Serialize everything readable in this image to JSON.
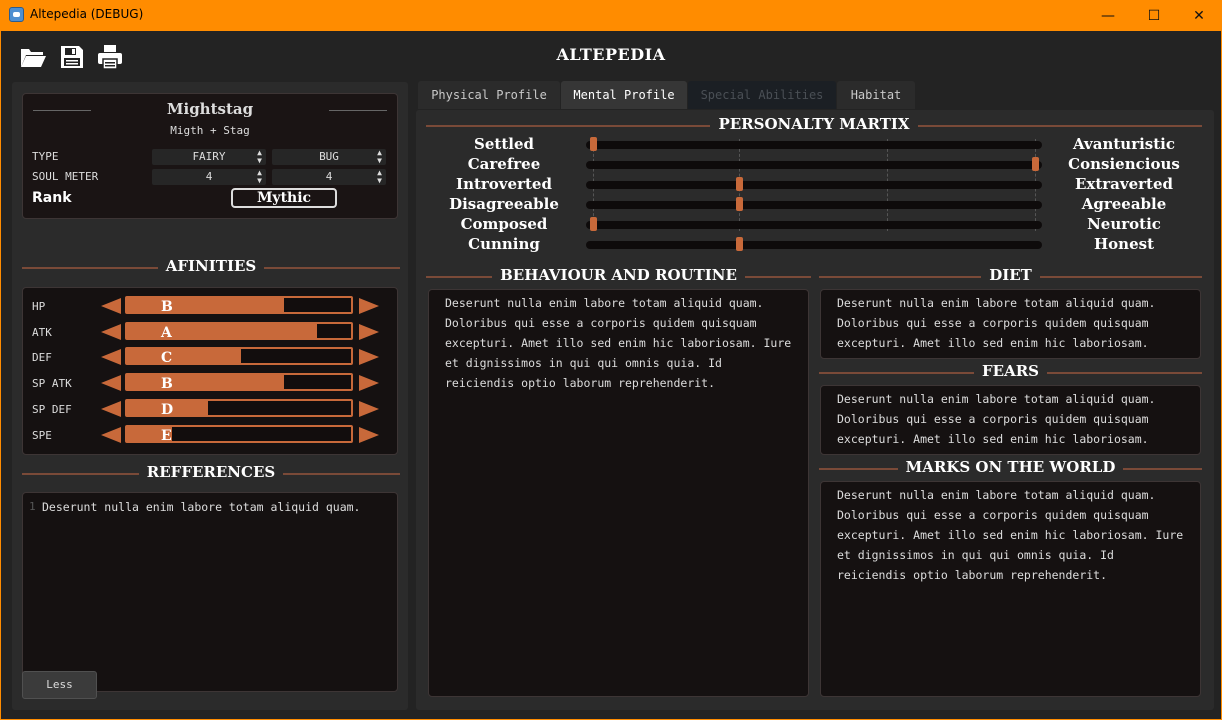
{
  "window": {
    "title": "Altepedia (DEBUG)",
    "controls": {
      "minimize": "—",
      "maximize": "☐",
      "close": "✕"
    }
  },
  "app": {
    "title": "ALTEPEDIA"
  },
  "toolbar": {
    "icons": [
      "folder-open-icon",
      "save-icon",
      "print-icon"
    ]
  },
  "creature": {
    "name": "Mightstag",
    "subtitle": "Migth + Stag",
    "type_label": "TYPE",
    "types": [
      "FAIRY",
      "BUG"
    ],
    "soul_meter_label": "SOUL METER",
    "soul_meter": [
      "4",
      "4"
    ],
    "rank_label": "Rank",
    "rank": "Mythic"
  },
  "affinities": {
    "heading": "AFINITIES",
    "rows": [
      {
        "stat": "HP",
        "grade": "B",
        "level": 0.7
      },
      {
        "stat": "ATK",
        "grade": "A",
        "level": 0.85
      },
      {
        "stat": "DEF",
        "grade": "C",
        "level": 0.51
      },
      {
        "stat": "SP ATK",
        "grade": "B",
        "level": 0.7
      },
      {
        "stat": "SP DEF",
        "grade": "D",
        "level": 0.36
      },
      {
        "stat": "SPE",
        "grade": "E",
        "level": 0.2
      }
    ]
  },
  "references": {
    "heading": "REFFERENCES",
    "line_number": "1",
    "text": "Deserunt nulla enim labore totam aliquid quam."
  },
  "less_button": "Less",
  "tabs": [
    {
      "label": "Physical Profile",
      "state": "normal"
    },
    {
      "label": "Mental Profile",
      "state": "active"
    },
    {
      "label": "Special Abilities",
      "state": "disabled"
    },
    {
      "label": "Habitat",
      "state": "normal"
    }
  ],
  "personality": {
    "heading": "PERSONALTY MARTIX",
    "traits": [
      {
        "left": "Settled",
        "right": "Avanturistic",
        "value": 0.0
      },
      {
        "left": "Carefree",
        "right": "Consiencious",
        "value": 1.0
      },
      {
        "left": "Introverted",
        "right": "Extraverted",
        "value": 0.33
      },
      {
        "left": "Disagreeable",
        "right": "Agreeable",
        "value": 0.33
      },
      {
        "left": "Composed",
        "right": "Neurotic",
        "value": 0.0
      },
      {
        "left": "Cunning",
        "right": "Honest",
        "value": 0.33
      }
    ]
  },
  "behaviour": {
    "heading": "BEHAVIOUR AND ROUTINE",
    "text": "Deserunt nulla enim labore totam aliquid quam. Doloribus qui esse a corporis quidem quisquam excepturi. Amet illo sed enim hic laboriosam. Iure et dignissimos in qui qui omnis quia. Id reiciendis optio laborum reprehenderit."
  },
  "diet": {
    "heading": "DIET",
    "text": "Deserunt nulla enim labore totam aliquid quam. Doloribus qui esse a corporis quidem quisquam excepturi. Amet illo sed enim hic laboriosam."
  },
  "fears": {
    "heading": "FEARS",
    "text": "Deserunt nulla enim labore totam aliquid quam. Doloribus qui esse a corporis quidem quisquam excepturi. Amet illo sed enim hic laboriosam."
  },
  "marks": {
    "heading": "MARKS ON THE WORLD",
    "text": "Deserunt nulla enim labore totam aliquid quam. Doloribus qui esse a corporis quidem quisquam excepturi. Amet illo sed enim hic laboriosam. Iure et dignissimos in qui qui omnis quia. Id reiciendis optio laborum reprehenderit."
  },
  "colors": {
    "accent": "#c8693a",
    "titlebar": "#ff8c00",
    "panel": "#2b2b2b",
    "textbox": "#151111"
  }
}
